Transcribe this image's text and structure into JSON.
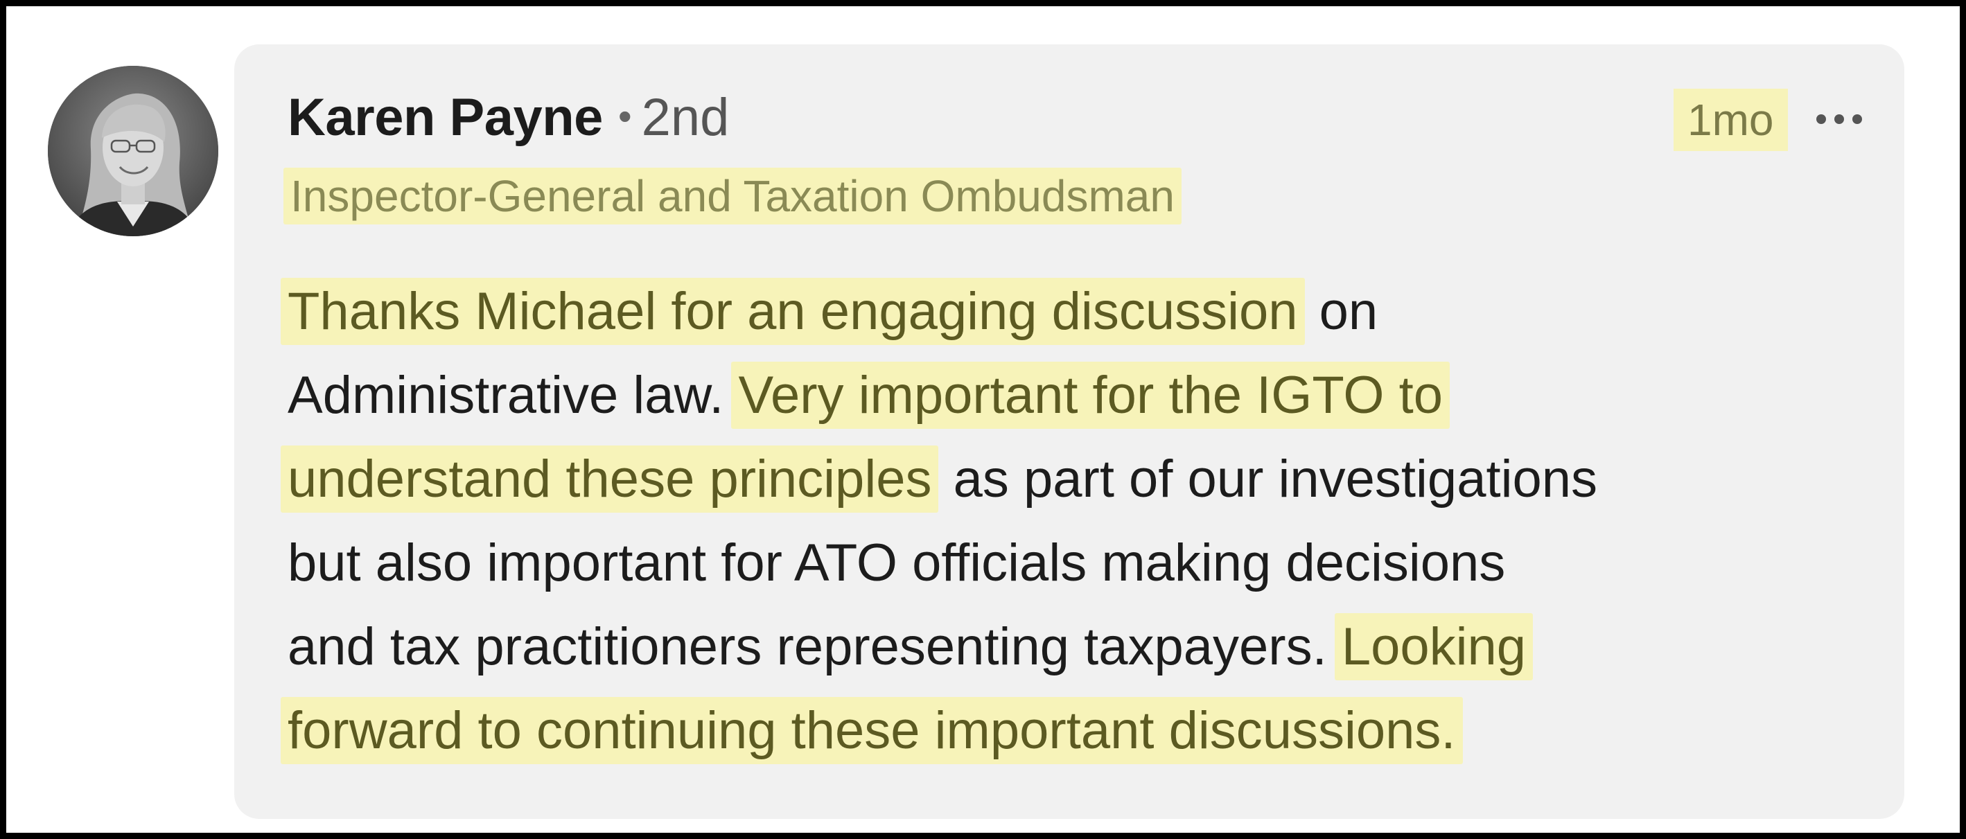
{
  "comment": {
    "author_name": "Karen Payne",
    "separator": "•",
    "connection_degree": "2nd",
    "author_headline": "Inspector-General and Taxation Ombudsman",
    "timestamp": "1mo",
    "more_icon": "more-horizontal-icon",
    "avatar_icon": "avatar-photo",
    "highlight_color": "#f7f3b9",
    "lines": {
      "l1_hl": "Thanks Michael for an engaging discussion",
      "l1_rest": " on",
      "l2_plain": "Administrative law. ",
      "l2_hl": "Very important for the IGTO to",
      "l3_hl": "understand these principles",
      "l3_rest": " as part of our investigations",
      "l4": "but also important for ATO officials making decisions",
      "l5_plain": "and tax practitioners representing taxpayers. ",
      "l5_hl": "Looking",
      "l6_hl": "forward to continuing these important discussions."
    }
  }
}
